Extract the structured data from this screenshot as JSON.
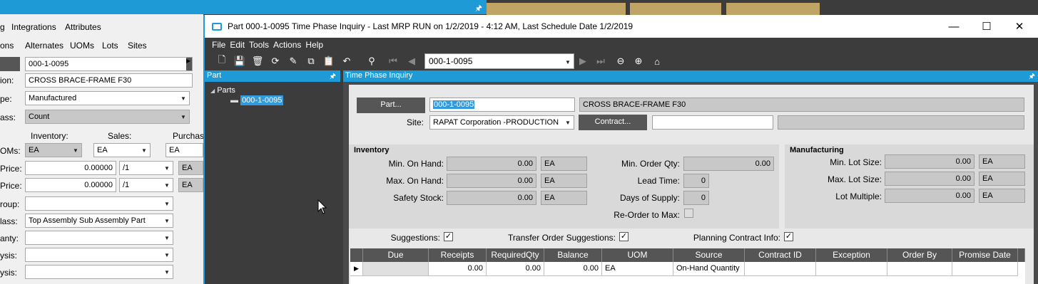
{
  "bg": {
    "tabs_row1": [
      "g",
      "Integrations",
      "Attributes"
    ],
    "tabs_row2": [
      "ons",
      "Alternates",
      "UOMs",
      "Lots",
      "Sites"
    ],
    "part_value": "000-1-0095",
    "desc_label": "ion:",
    "desc_value": "CROSS BRACE-FRAME F30",
    "type_label": "pe:",
    "type_value": "Manufactured",
    "class_label": "ass:",
    "class_value": "Count",
    "inv_header": "Inventory:",
    "sales_header": "Sales:",
    "purch_header": "Purchas",
    "uoms_label": "OMs:",
    "uom_inv": "EA",
    "uom_sales": "EA",
    "uom_purch": "EA",
    "price1_label": "Price:",
    "price1_value": "0.00000",
    "price1_per": "/1",
    "price1_uom": "EA",
    "price2_label": "Price:",
    "price2_value": "0.00000",
    "price2_per": "/1",
    "price2_uom": "EA",
    "group_label": "roup:",
    "class2_label": "lass:",
    "class2_value": "Top Assembly Sub Assembly Part",
    "qty_label": "anty:",
    "ysis1_label": "ysis:",
    "ysis2_label": "ysis:"
  },
  "window": {
    "title": "Part 000-1-0095 Time Phase Inquiry  - Last MRP RUN on 1/2/2019 - 4:12 AM, Last Schedule Date  1/2/2019",
    "menu": [
      "File",
      "Edit",
      "Tools",
      "Actions",
      "Help"
    ],
    "toolbar_part": "000-1-0095"
  },
  "left_panel": {
    "title": "Part",
    "tree_root": "Parts",
    "tree_item": "000-1-0095"
  },
  "right_panel": {
    "title": "Time Phase Inquiry",
    "part_btn": "Part...",
    "part_value": "000-1-0095",
    "part_desc": "CROSS BRACE-FRAME F30",
    "site_label": "Site:",
    "site_value": "RAPAT Corporation -PRODUCTION",
    "contract_btn": "Contract...",
    "inventory": {
      "title": "Inventory",
      "min_on_hand_label": "Min. On Hand:",
      "min_on_hand": "0.00",
      "min_on_hand_uom": "EA",
      "max_on_hand_label": "Max. On Hand:",
      "max_on_hand": "0.00",
      "max_on_hand_uom": "EA",
      "safety_label": "Safety Stock:",
      "safety": "0.00",
      "safety_uom": "EA",
      "min_order_label": "Min. Order Qty:",
      "min_order": "0.00",
      "lead_label": "Lead Time:",
      "lead": "0",
      "days_label": "Days of Supply:",
      "days": "0",
      "reorder_label": "Re-Order to Max:"
    },
    "manufacturing": {
      "title": "Manufacturing",
      "min_lot_label": "Min. Lot Size:",
      "min_lot": "0.00",
      "min_lot_uom": "EA",
      "max_lot_label": "Max. Lot Size:",
      "max_lot": "0.00",
      "max_lot_uom": "EA",
      "lot_mult_label": "Lot Multiple:",
      "lot_mult": "0.00",
      "lot_mult_uom": "EA"
    },
    "suggestions_label": "Suggestions:",
    "transfer_label": "Transfer Order Suggestions:",
    "planning_label": "Planning Contract Info:",
    "check_mark": "✓",
    "grid": {
      "headers": [
        "Due",
        "Receipts",
        "RequiredQty",
        "Balance",
        "UOM",
        "Source",
        "Contract ID",
        "Exception",
        "Order By",
        "Promise Date"
      ],
      "row": [
        "",
        "0.00",
        "0.00",
        "0.00",
        "EA",
        "On-Hand Quantity",
        "",
        "",
        "",
        ""
      ]
    }
  }
}
